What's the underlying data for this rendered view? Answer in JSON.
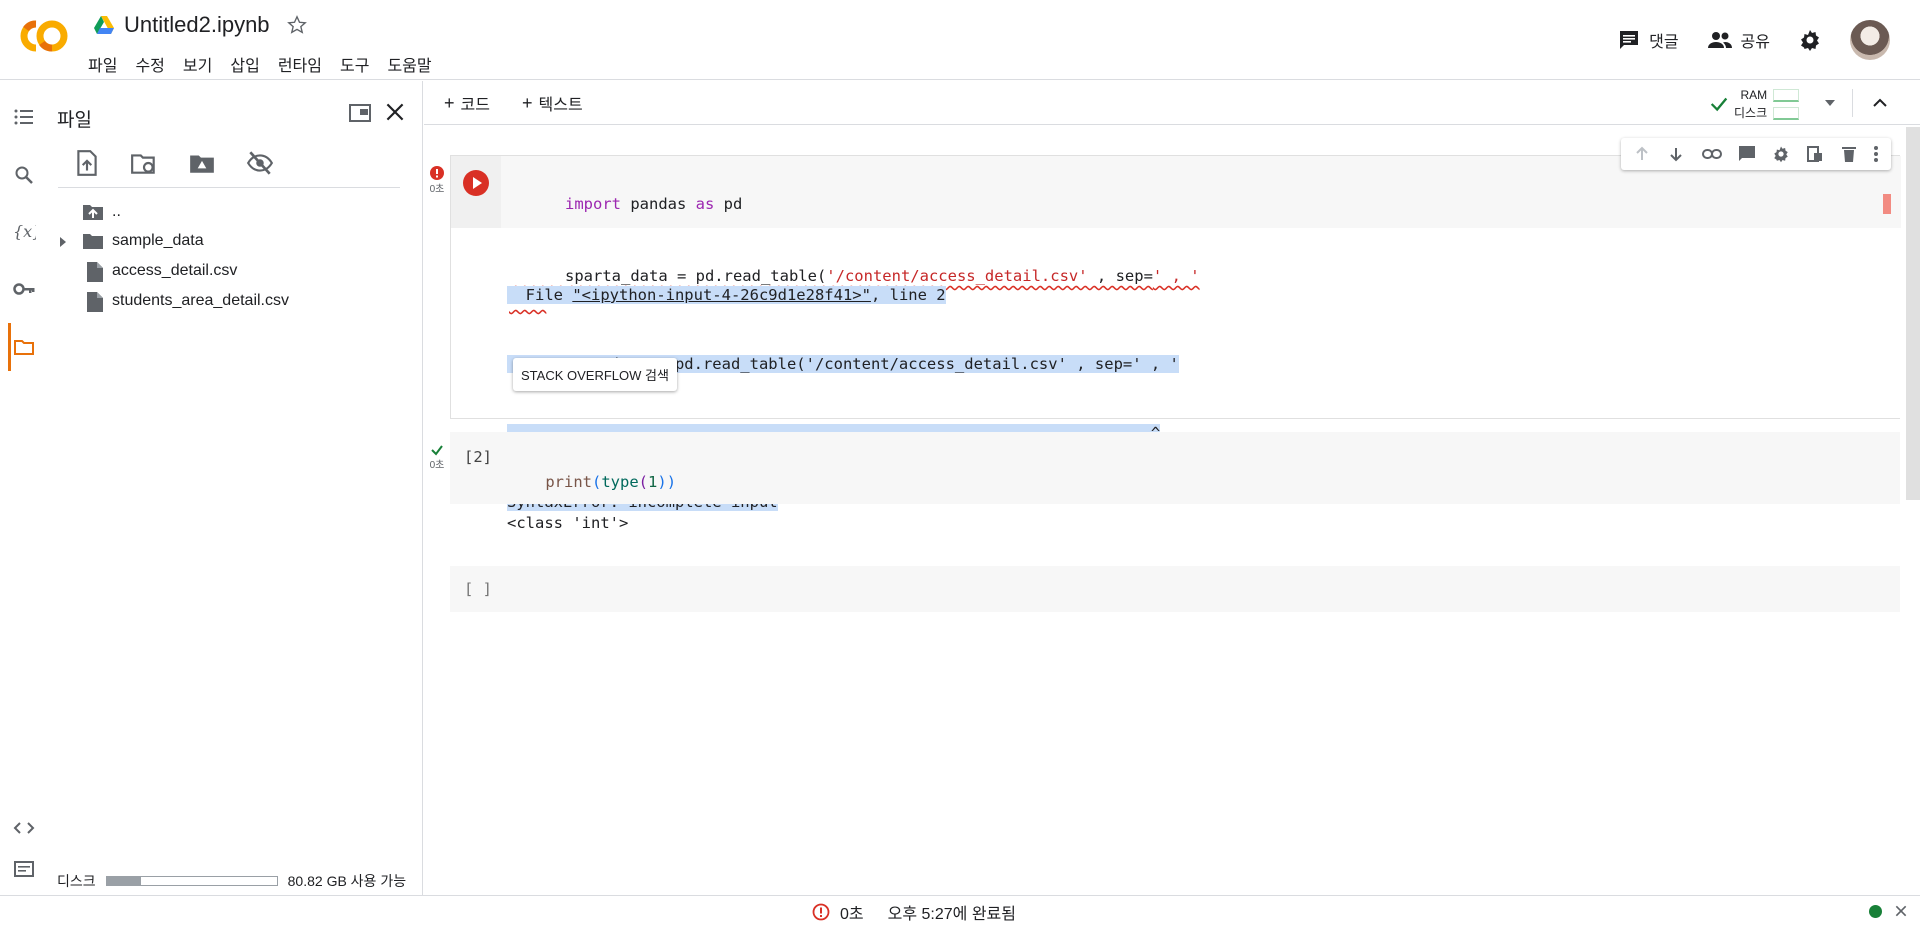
{
  "header": {
    "title": "Untitled2.ipynb",
    "menu": [
      "파일",
      "수정",
      "보기",
      "삽입",
      "런타임",
      "도구",
      "도움말"
    ],
    "comment_label": "댓글",
    "share_label": "공유"
  },
  "file_panel": {
    "title": "파일",
    "items": [
      {
        "name": "..",
        "type": "parent"
      },
      {
        "name": "sample_data",
        "type": "folder"
      },
      {
        "name": "access_detail.csv",
        "type": "file"
      },
      {
        "name": "students_area_detail.csv",
        "type": "file"
      }
    ],
    "disk_label": "디스크",
    "disk_available": "80.82 GB 사용 가능",
    "disk_used_fraction": 0.2
  },
  "toolbar": {
    "add_code": "코드",
    "add_text": "텍스트",
    "ram_label": "RAM",
    "disk_label": "디스크"
  },
  "cells": {
    "cell1": {
      "time": "0초",
      "line1": {
        "kw1": "import",
        "t1": " pandas ",
        "kw2": "as",
        "t2": " pd"
      },
      "line2": {
        "t1": "sparta_data = pd.read_table(",
        "str": "'/content/access_detail.csv'",
        "t2": " , sep=",
        "str2": "' , '"
      },
      "output": {
        "l1_a": "  File ",
        "l1_b": "\"<ipython-input-4-26c9d1e28f41>\"",
        "l1_c": ", line 2",
        "l2": "    sparta_data = pd.read_table('/content/access_detail.csv' , sep=' , '",
        "l3": "                                                                     ^",
        "l4": "SyntaxError: incomplete input"
      },
      "so_button": "STACK OVERFLOW 검색"
    },
    "cell2": {
      "time": "0초",
      "exec_count": "[2]",
      "code_fn": "print",
      "code_p1": "(",
      "code_bi": "type",
      "code_p2": "(",
      "code_num": "1",
      "code_p3": "))",
      "output": "<class 'int'>"
    },
    "cell3": {
      "exec_count": "[ ]"
    }
  },
  "statusbar": {
    "time": "0초",
    "message": "오후 5:27에 완료됨"
  },
  "colors": {
    "accent": "#e8710a",
    "error": "#d93025",
    "success": "#188038"
  }
}
